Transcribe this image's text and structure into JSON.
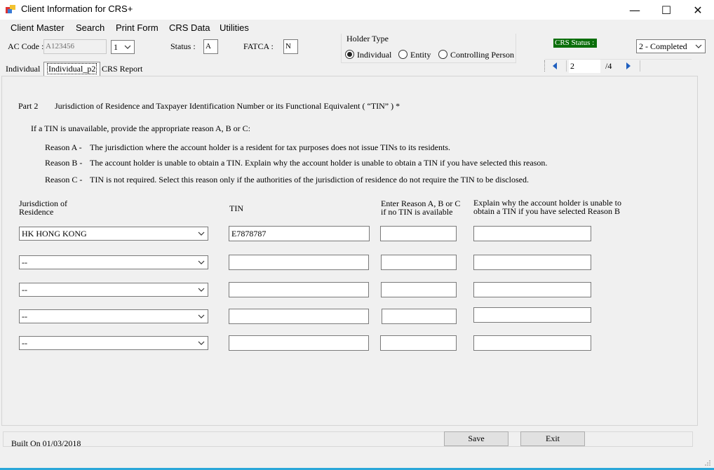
{
  "window": {
    "title": "Client Information for CRS+",
    "minimize_glyph": "—",
    "maximize_glyph": "☐",
    "close_glyph": "✕"
  },
  "menu": [
    "Client Master",
    "Search",
    "Print Form",
    "CRS Data",
    "Utilities"
  ],
  "header": {
    "ac_code_label": "AC Code :",
    "ac_code_value": "A123456",
    "ac_seq_value": "1",
    "status_label": "Status :",
    "status_value": "A",
    "fatca_label": "FATCA :",
    "fatca_value": "N",
    "holder_type_title": "Holder Type",
    "holder_types": [
      "Individual",
      "Entity",
      "Controlling Person"
    ],
    "holder_type_selected": "Individual",
    "crs_status_label": "CRS Status :",
    "crs_status_value": "2 - Completed",
    "page_current": "2",
    "page_total": "/4"
  },
  "tabs": [
    "Individual",
    "Individual_p2",
    "CRS Report"
  ],
  "active_tab": "Individual_p2",
  "content": {
    "part_label": "Part 2",
    "part_title": "Jurisdiction of Residence and Taxpayer Identification Number or its Functional Equivalent ( “TIN” )  *",
    "intro": "If a TIN is unavailable, provide the appropriate reason A, B or C:",
    "reasons": [
      {
        "label": "Reason A  -",
        "text": "The jurisdiction where the account holder is a resident for tax purposes does not issue TINs to its residents."
      },
      {
        "label": "Reason B  -",
        "text": "The account holder is unable to obtain a TIN. Explain why the account holder is unable to obtain a TIN if you have selected this reason."
      },
      {
        "label": "Reason C  -",
        "text": "TIN is not required. Select this reason only if the authorities of the jurisdiction of residence do not require the TIN to be disclosed."
      }
    ],
    "columns": {
      "jurisdiction_1": "Jurisdiction of",
      "jurisdiction_2": "Residence",
      "tin": "TIN",
      "reason_1": "Enter Reason A, B or C",
      "reason_2": "if no TIN is available",
      "explain_1": "Explain why the account holder is unable to",
      "explain_2": "obtain a TIN if you have selected Reason B"
    },
    "rows": [
      {
        "jurisdiction": "HK  HONG KONG",
        "tin": "E7878787",
        "reason": "",
        "explain": ""
      },
      {
        "jurisdiction": "--",
        "tin": "",
        "reason": "",
        "explain": ""
      },
      {
        "jurisdiction": "--",
        "tin": "",
        "reason": "",
        "explain": ""
      },
      {
        "jurisdiction": "--",
        "tin": "",
        "reason": "",
        "explain": ""
      },
      {
        "jurisdiction": "--",
        "tin": "",
        "reason": "",
        "explain": ""
      }
    ]
  },
  "footer": {
    "built_on": "Built On  01/03/2018",
    "save_label": "Save",
    "exit_label": "Exit"
  },
  "colors": {
    "crs_status_bg": "#0a6e0a",
    "nav_arrow": "#1f5fbf",
    "bottom_accent": "#2aa7d9"
  }
}
